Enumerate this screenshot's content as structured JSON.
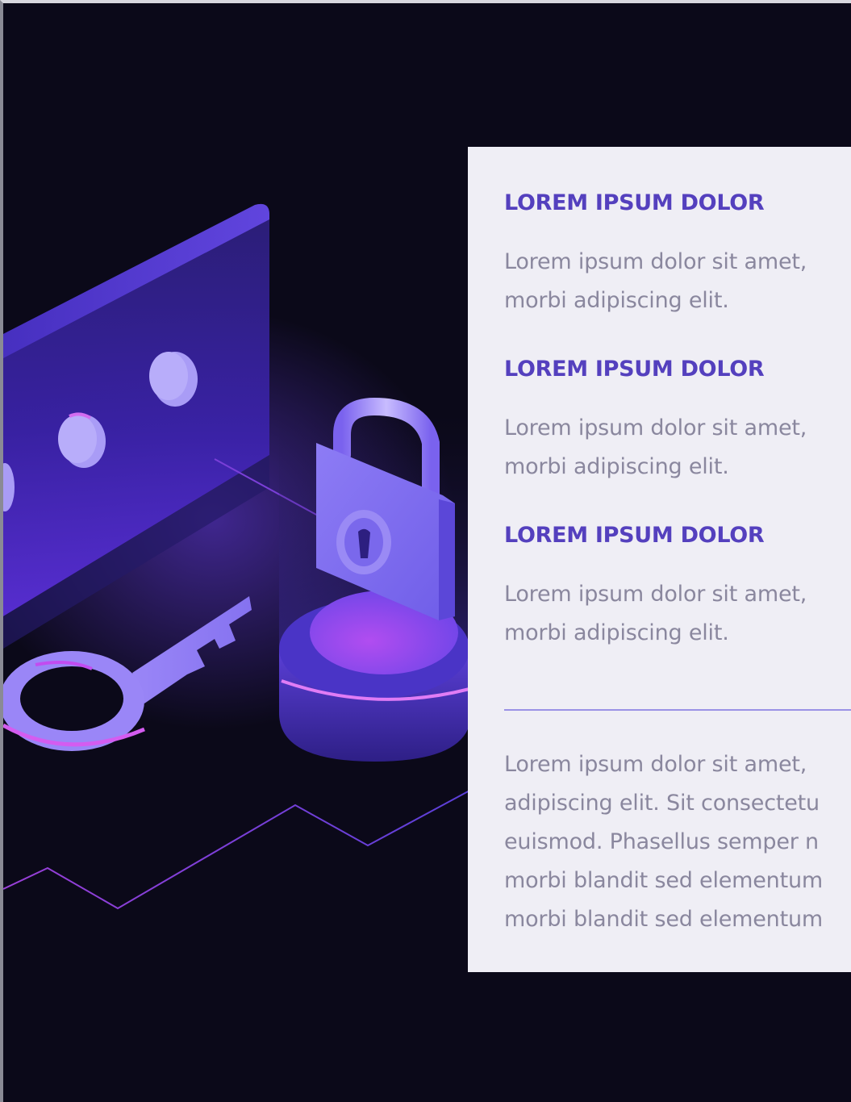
{
  "features": [
    {
      "heading": "LOREM IPSUM DOLOR",
      "text_line1": "Lorem ipsum dolor sit amet,",
      "text_line2": "morbi adipiscing elit."
    },
    {
      "heading": "LOREM IPSUM DOLOR",
      "text_line1": "Lorem ipsum dolor sit amet,",
      "text_line2": "morbi adipiscing elit."
    },
    {
      "heading": "LOREM IPSUM DOLOR",
      "text_line1": "Lorem ipsum dolor sit amet,",
      "text_line2": "morbi adipiscing elit."
    }
  ],
  "summary": {
    "text": "Lorem ipsum dolor sit amet,\nadipiscing elit. Sit consectetu\neuismod. Phasellus semper n\nmorbi blandit sed elementum\nmorbi blandit sed elementum"
  },
  "illustration": {
    "icons": [
      "password-card-icon",
      "lock-icon",
      "key-icon",
      "pedestal-icon"
    ]
  },
  "colors": {
    "background": "#0b0919",
    "card": "#efeef5",
    "heading": "#5440be",
    "body_text": "#8a879e",
    "divider": "#9a92e6",
    "accent_purple": "#7b5cf0",
    "accent_magenta": "#c04ef0"
  }
}
